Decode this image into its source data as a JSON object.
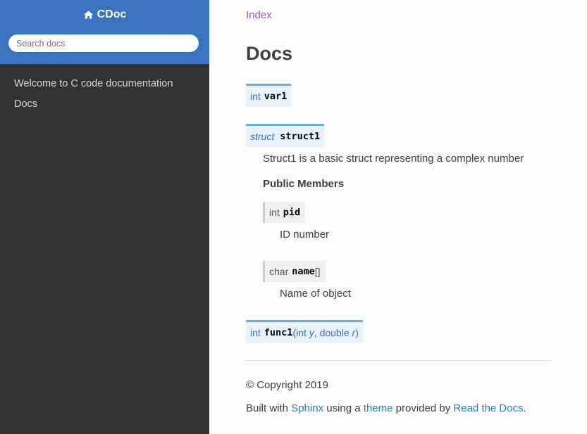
{
  "sidebar": {
    "brand": "CDoc",
    "search_placeholder": "Search docs",
    "nav": [
      {
        "label": "Welcome to C code documentation"
      },
      {
        "label": "Docs"
      }
    ]
  },
  "breadcrumb": {
    "label": "Index"
  },
  "page": {
    "title": "Docs",
    "var1": {
      "type": "int",
      "name": "var1"
    },
    "struct1": {
      "keyword": "struct",
      "name": "struct1",
      "description": "Struct1 is a basic struct representing a complex number",
      "members_heading": "Public Members",
      "members": [
        {
          "type": "int",
          "name": "pid",
          "suffix": "",
          "description": "ID number"
        },
        {
          "type": "char",
          "name": "name",
          "suffix": "[]",
          "description": "Name of object"
        }
      ]
    },
    "func1": {
      "type": "int",
      "name": "func1",
      "params_open": "(",
      "p1_type": "int ",
      "p1_name": "y",
      "sep": ", ",
      "p2_type": "double ",
      "p2_name": "r",
      "params_close": ")"
    }
  },
  "footer": {
    "copyright": "© Copyright 2019",
    "built_prefix": "Built with ",
    "sphinx": "Sphinx",
    "using": " using a ",
    "theme": "theme",
    "provided": " provided by ",
    "rtd": "Read the Docs",
    "period": "."
  },
  "colors": {
    "sidebar_top": "#3a73bf",
    "sidebar_bg": "#343131",
    "link": "#2980b9",
    "visited_link": "#9b59b6"
  }
}
